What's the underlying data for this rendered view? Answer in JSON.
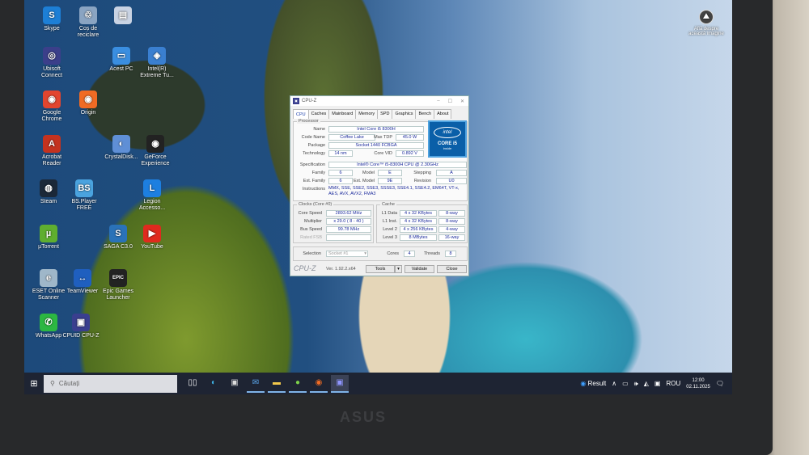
{
  "desktop": {
    "icons": [
      {
        "label": "Skype",
        "glyph": "S",
        "color": "#1d7fd6"
      },
      {
        "label": "Coș de reciclare",
        "glyph": "♲",
        "color": "#8aa4c2"
      },
      {
        "label": "",
        "glyph": "▤",
        "color": "#c9d3e3"
      },
      {
        "label": "Ubisoft Connect",
        "glyph": "◎",
        "color": "#3b3f8a"
      },
      {
        "label": "Acest PC",
        "glyph": "▭",
        "color": "#3a8ee0"
      },
      {
        "label": "Intel(R) Extreme Tu...",
        "glyph": "◈",
        "color": "#3a7fd0"
      },
      {
        "label": "Google Chrome",
        "glyph": "◉",
        "color": "#e2452f"
      },
      {
        "label": "Origin",
        "glyph": "◉",
        "color": "#f06b24"
      },
      {
        "label": "Acrobat Reader",
        "glyph": "A",
        "color": "#c4321f"
      },
      {
        "label": "CrystalDisk...",
        "glyph": "◐",
        "color": "#5f8fd6"
      },
      {
        "label": "GeForce Experience",
        "glyph": "◉",
        "color": "#222"
      },
      {
        "label": "Steam",
        "glyph": "◍",
        "color": "#1b2838"
      },
      {
        "label": "BS.Player FREE",
        "glyph": "BS",
        "color": "#4aa3df"
      },
      {
        "label": "Legion Accesso...",
        "glyph": "L",
        "color": "#1d7fe0"
      },
      {
        "label": "µTorrent",
        "glyph": "µ",
        "color": "#5fae2f"
      },
      {
        "label": "SAGA C3.0",
        "glyph": "S",
        "color": "#2a72b8"
      },
      {
        "label": "YouTube",
        "glyph": "▶",
        "color": "#e02a1e"
      },
      {
        "label": "ESET Online Scanner",
        "glyph": "e",
        "color": "#9fb7c9"
      },
      {
        "label": "TeamViewer",
        "glyph": "↔",
        "color": "#1f5fbf"
      },
      {
        "label": "Epic Games Launcher",
        "glyph": "EPIC",
        "color": "#222"
      },
      {
        "label": "WhatsApp",
        "glyph": "✆",
        "color": "#2cb742"
      },
      {
        "label": "CPUID CPU-Z",
        "glyph": "▣",
        "color": "#3a3f8f"
      }
    ],
    "about_image": "Află despre această imagine"
  },
  "cpuz": {
    "title": "CPU-Z",
    "tabs": [
      "CPU",
      "Caches",
      "Mainboard",
      "Memory",
      "SPD",
      "Graphics",
      "Bench",
      "About"
    ],
    "processor": {
      "group": "Processor",
      "name_label": "Name",
      "name": "Intel Core i5 8300H",
      "codename_label": "Code Name",
      "codename": "Coffee Lake",
      "maxtdp_label": "Max TDP",
      "maxtdp": "45.0 W",
      "package_label": "Package",
      "package": "Socket 1440 FCBGA",
      "technology_label": "Technology",
      "technology": "14 nm",
      "corevid_label": "Core VID",
      "corevid": "0.892 V",
      "spec_label": "Specification",
      "spec": "Intel® Core™ i5-8300H CPU @ 2.30GHz",
      "family_label": "Family",
      "family": "6",
      "model_label": "Model",
      "model": "E",
      "stepping_label": "Stepping",
      "stepping": "A",
      "extfamily_label": "Ext. Family",
      "extfamily": "6",
      "extmodel_label": "Ext. Model",
      "extmodel": "9E",
      "revision_label": "Revision",
      "revision": "U0",
      "instructions_label": "Instructions",
      "instructions": "MMX, SSE, SSE2, SSE3, SSSE3, SSE4.1, SSE4.2, EM64T, VT-x, AES, AVX, AVX2, FMA3",
      "logo_brand": "intel",
      "logo_model": "CORE i5",
      "logo_gen": "inside"
    },
    "clocks": {
      "group": "Clocks (Core #0)",
      "core_speed_label": "Core Speed",
      "core_speed": "2893.62 MHz",
      "multiplier_label": "Multiplier",
      "multiplier": "x 29.0 ( 8 - 40 )",
      "bus_label": "Bus Speed",
      "bus": "99.78 MHz",
      "rated_label": "Rated FSB",
      "rated": ""
    },
    "cache": {
      "group": "Cache",
      "rows": [
        {
          "label": "L1 Data",
          "size": "4 x 32 KBytes",
          "way": "8-way"
        },
        {
          "label": "L1 Inst.",
          "size": "4 x 32 KBytes",
          "way": "8-way"
        },
        {
          "label": "Level 2",
          "size": "4 x 256 KBytes",
          "way": "4-way"
        },
        {
          "label": "Level 3",
          "size": "8 MBytes",
          "way": "16-way"
        }
      ]
    },
    "selection_label": "Selection",
    "selection": "Socket #1",
    "cores_label": "Cores",
    "cores": "4",
    "threads_label": "Threads",
    "threads": "8",
    "brand": "CPU-Z",
    "version": "Ver. 1.92.2.x64",
    "tools": "Tools",
    "validate": "Validate",
    "close": "Close"
  },
  "taskbar": {
    "search_placeholder": "Căutați",
    "weather": "Result",
    "language": "ROU",
    "time": "12:00",
    "date": "02.11.2025"
  },
  "bezel_logo": "ASUS"
}
